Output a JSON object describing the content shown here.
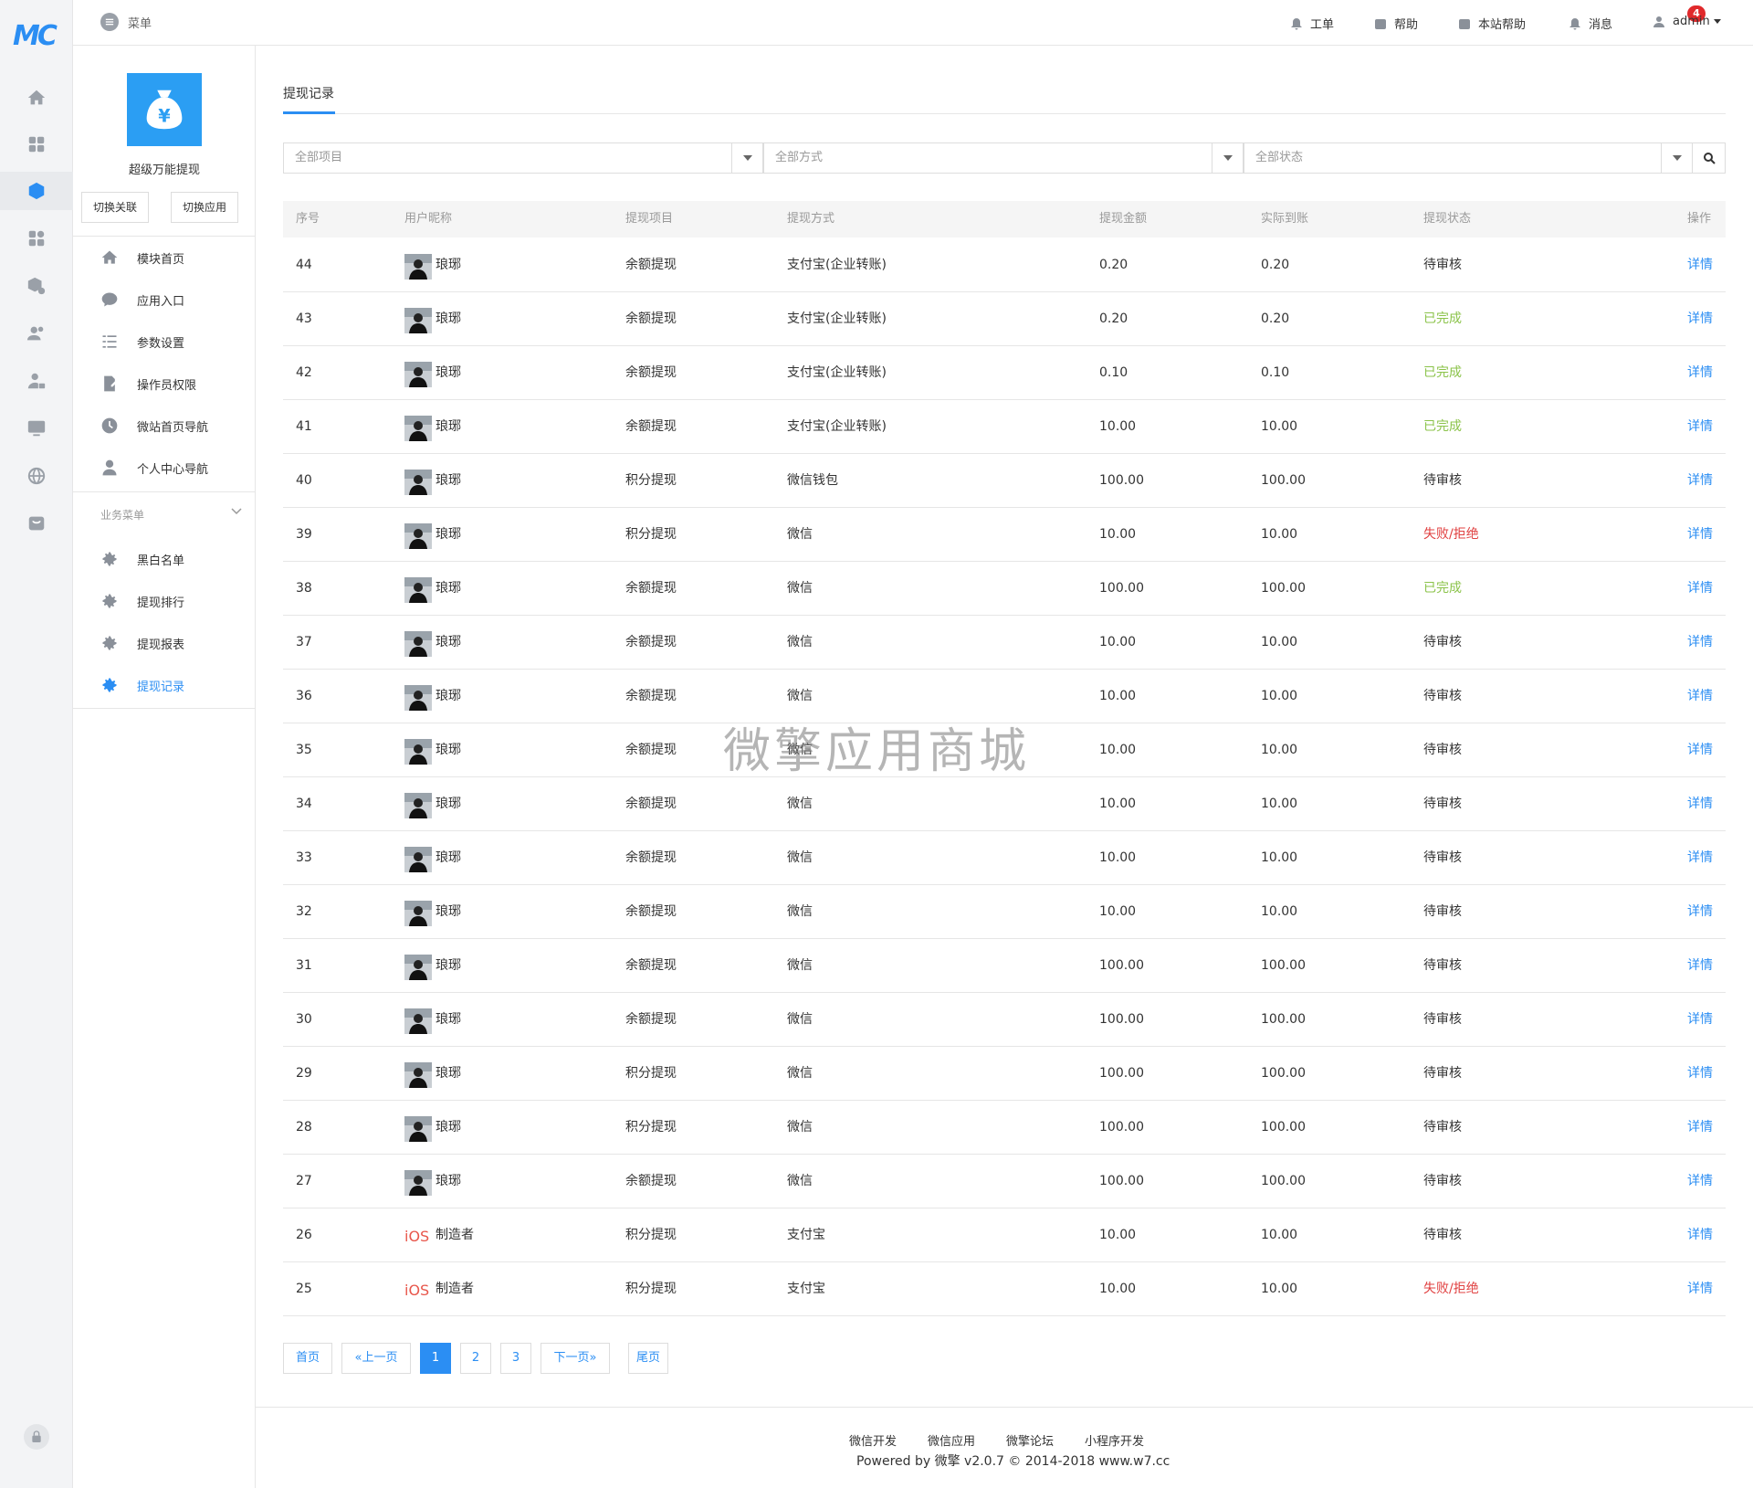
{
  "brand": {
    "logo_text": "MC",
    "accent": "#2b8ef3"
  },
  "topbar": {
    "menu_label": "菜单",
    "links": [
      {
        "label": "工单",
        "icon": "bell-icon"
      },
      {
        "label": "帮助",
        "icon": "help-icon"
      },
      {
        "label": "本站帮助",
        "icon": "help-icon"
      },
      {
        "label": "消息",
        "icon": "bell-icon"
      }
    ],
    "message_badge": "4",
    "user": "admin"
  },
  "sidebar": {
    "app_name": "超级万能提现",
    "switch_link": "切换关联",
    "switch_app": "切换应用",
    "items": [
      {
        "label": "模块首页"
      },
      {
        "label": "应用入口"
      },
      {
        "label": "参数设置"
      },
      {
        "label": "操作员权限"
      },
      {
        "label": "微站首页导航"
      },
      {
        "label": "个人中心导航"
      }
    ],
    "group_title": "业务菜单",
    "group_items": [
      {
        "label": "黑白名单"
      },
      {
        "label": "提现排行"
      },
      {
        "label": "提现报表"
      },
      {
        "label": "提现记录"
      }
    ]
  },
  "tab": {
    "label": "提现记录"
  },
  "filters": {
    "project": "全部项目",
    "method": "全部方式",
    "status": "全部状态"
  },
  "table": {
    "headers": [
      "序号",
      "用户昵称",
      "提现项目",
      "提现方式",
      "提现金额",
      "实际到账",
      "提现状态",
      "操作"
    ],
    "rows": [
      {
        "id": "44",
        "avatar": "photo",
        "nick": "琅琊",
        "project": "余额提现",
        "method": "支付宝(企业转账)",
        "amount": "0.20",
        "actual": "0.20",
        "status": "待审核",
        "status_type": "pending",
        "op": "详情"
      },
      {
        "id": "43",
        "avatar": "photo",
        "nick": "琅琊",
        "project": "余额提现",
        "method": "支付宝(企业转账)",
        "amount": "0.20",
        "actual": "0.20",
        "status": "已完成",
        "status_type": "done",
        "op": "详情"
      },
      {
        "id": "42",
        "avatar": "photo",
        "nick": "琅琊",
        "project": "余额提现",
        "method": "支付宝(企业转账)",
        "amount": "0.10",
        "actual": "0.10",
        "status": "已完成",
        "status_type": "done",
        "op": "详情"
      },
      {
        "id": "41",
        "avatar": "photo",
        "nick": "琅琊",
        "project": "余额提现",
        "method": "支付宝(企业转账)",
        "amount": "10.00",
        "actual": "10.00",
        "status": "已完成",
        "status_type": "done",
        "op": "详情"
      },
      {
        "id": "40",
        "avatar": "photo",
        "nick": "琅琊",
        "project": "积分提现",
        "method": "微信钱包",
        "amount": "100.00",
        "actual": "100.00",
        "status": "待审核",
        "status_type": "pending",
        "op": "详情"
      },
      {
        "id": "39",
        "avatar": "photo",
        "nick": "琅琊",
        "project": "积分提现",
        "method": "微信",
        "amount": "10.00",
        "actual": "10.00",
        "status": "失败/拒绝",
        "status_type": "fail",
        "op": "详情"
      },
      {
        "id": "38",
        "avatar": "photo",
        "nick": "琅琊",
        "project": "余额提现",
        "method": "微信",
        "amount": "100.00",
        "actual": "100.00",
        "status": "已完成",
        "status_type": "done",
        "op": "详情"
      },
      {
        "id": "37",
        "avatar": "photo",
        "nick": "琅琊",
        "project": "余额提现",
        "method": "微信",
        "amount": "10.00",
        "actual": "10.00",
        "status": "待审核",
        "status_type": "pending",
        "op": "详情"
      },
      {
        "id": "36",
        "avatar": "photo",
        "nick": "琅琊",
        "project": "余额提现",
        "method": "微信",
        "amount": "10.00",
        "actual": "10.00",
        "status": "待审核",
        "status_type": "pending",
        "op": "详情"
      },
      {
        "id": "35",
        "avatar": "photo",
        "nick": "琅琊",
        "project": "余额提现",
        "method": "微信",
        "amount": "10.00",
        "actual": "10.00",
        "status": "待审核",
        "status_type": "pending",
        "op": "详情"
      },
      {
        "id": "34",
        "avatar": "photo",
        "nick": "琅琊",
        "project": "余额提现",
        "method": "微信",
        "amount": "10.00",
        "actual": "10.00",
        "status": "待审核",
        "status_type": "pending",
        "op": "详情"
      },
      {
        "id": "33",
        "avatar": "photo",
        "nick": "琅琊",
        "project": "余额提现",
        "method": "微信",
        "amount": "10.00",
        "actual": "10.00",
        "status": "待审核",
        "status_type": "pending",
        "op": "详情"
      },
      {
        "id": "32",
        "avatar": "photo",
        "nick": "琅琊",
        "project": "余额提现",
        "method": "微信",
        "amount": "10.00",
        "actual": "10.00",
        "status": "待审核",
        "status_type": "pending",
        "op": "详情"
      },
      {
        "id": "31",
        "avatar": "photo",
        "nick": "琅琊",
        "project": "余额提现",
        "method": "微信",
        "amount": "100.00",
        "actual": "100.00",
        "status": "待审核",
        "status_type": "pending",
        "op": "详情"
      },
      {
        "id": "30",
        "avatar": "photo",
        "nick": "琅琊",
        "project": "余额提现",
        "method": "微信",
        "amount": "100.00",
        "actual": "100.00",
        "status": "待审核",
        "status_type": "pending",
        "op": "详情"
      },
      {
        "id": "29",
        "avatar": "photo",
        "nick": "琅琊",
        "project": "积分提现",
        "method": "微信",
        "amount": "100.00",
        "actual": "100.00",
        "status": "待审核",
        "status_type": "pending",
        "op": "详情"
      },
      {
        "id": "28",
        "avatar": "photo",
        "nick": "琅琊",
        "project": "积分提现",
        "method": "微信",
        "amount": "100.00",
        "actual": "100.00",
        "status": "待审核",
        "status_type": "pending",
        "op": "详情"
      },
      {
        "id": "27",
        "avatar": "photo",
        "nick": "琅琊",
        "project": "余额提现",
        "method": "微信",
        "amount": "100.00",
        "actual": "100.00",
        "status": "待审核",
        "status_type": "pending",
        "op": "详情"
      },
      {
        "id": "26",
        "avatar": "ios",
        "avatar_text": "iOS",
        "nick": "制造者",
        "project": "积分提现",
        "method": "支付宝",
        "amount": "10.00",
        "actual": "10.00",
        "status": "待审核",
        "status_type": "pending",
        "op": "详情"
      },
      {
        "id": "25",
        "avatar": "ios",
        "avatar_text": "iOS",
        "nick": "制造者",
        "project": "积分提现",
        "method": "支付宝",
        "amount": "10.00",
        "actual": "10.00",
        "status": "失败/拒绝",
        "status_type": "fail",
        "op": "详情"
      }
    ]
  },
  "pagination": {
    "first": "首页",
    "prev": "«上一页",
    "pages": [
      "1",
      "2",
      "3"
    ],
    "current": "1",
    "next": "下一页»",
    "last": "尾页"
  },
  "footer": {
    "links": [
      "微信开发",
      "微信应用",
      "微擎论坛",
      "小程序开发"
    ],
    "copyright": "Powered by 微擎 v2.0.7 © 2014-2018 www.w7.cc"
  },
  "watermark": "微擎应用商城",
  "colors": {
    "done": "#8bc34a",
    "fail": "#e04040",
    "link": "#2b8ef3"
  }
}
